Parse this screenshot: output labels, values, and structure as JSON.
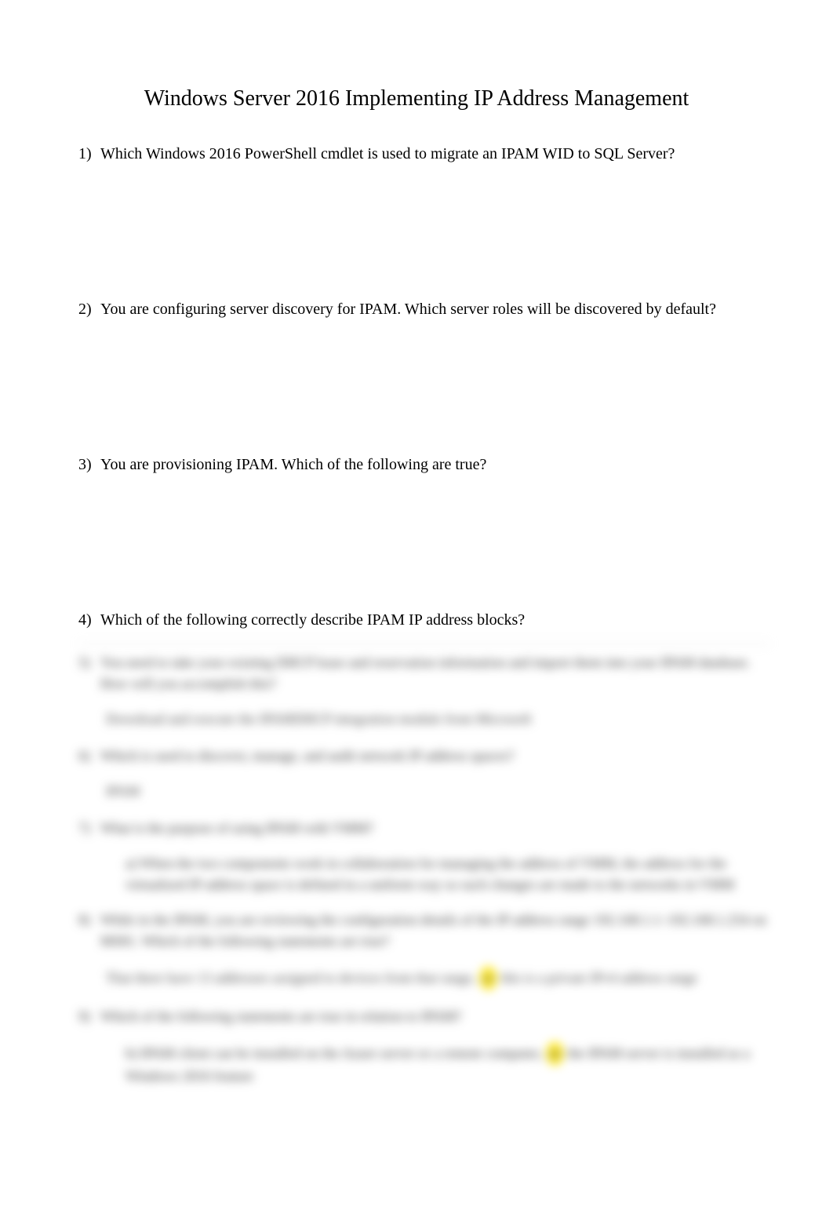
{
  "title": "Windows Server 2016 Implementing IP Address Management",
  "questions": [
    {
      "num": "1)",
      "text": "Which Windows 2016 PowerShell cmdlet is used to migrate an IPAM WID to SQL Server?"
    },
    {
      "num": "2)",
      "text": "You are configuring server discovery for IPAM. Which server roles will be discovered by default?"
    },
    {
      "num": "3)",
      "text": "You are provisioning IPAM. Which of the following are true?"
    },
    {
      "num": "4)",
      "text": "Which of the following correctly describe IPAM IP address blocks?"
    }
  ],
  "blurred": [
    {
      "num": "5)",
      "text": "You need to take your existing DHCP lease and reservation information and import them into your IPAM database. How will you accomplish this?",
      "answer": "Download and execute the IPAMDHCP integration module from Microsoft"
    },
    {
      "num": "6)",
      "text": "Which is used to discover, manage, and audit network IP address spaces?",
      "answer": "IPAM"
    },
    {
      "num": "7)",
      "text": "What is the purpose of using IPAM with VMM?",
      "subnum": "a)",
      "subtext": "When the two components work in collaboration for managing the address of VMM, the address for the virtualized IP address space is defined in a uniform way so such changes are made to the networks in VMM",
      "highlight": "on"
    },
    {
      "num": "8)",
      "text": "While in the IPAM, you are reviewing the configuration details of the IP address range 192.168.1.1–192.168.1.254 on MS81. Which of the following statements are true?",
      "answer": "That there have 13 addresses assigned to devices from that range,",
      "highlight": "or",
      "answer2": " this is a private IPv4 address range"
    },
    {
      "num": "9)",
      "text": "Which of the following statements are true in relation to IPAM?",
      "subnum": "b)",
      "subtext": "IPAM client can be installed on the Azure server or a remote computer,",
      "highlight": "or",
      "subtext2": " the IPAM server is installed as a Windows 2016 feature"
    }
  ]
}
